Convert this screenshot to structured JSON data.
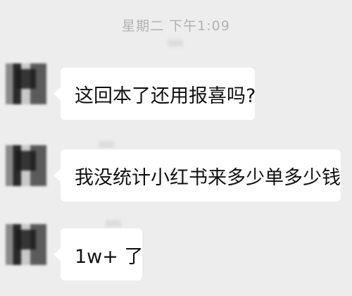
{
  "chat": {
    "timestamp": "星期二 下午1:09",
    "messages": [
      {
        "text": "这回本了还用报喜吗?"
      },
      {
        "text": "我没统计小红书来多少单多少钱"
      },
      {
        "text": "1w+ 了"
      }
    ]
  }
}
